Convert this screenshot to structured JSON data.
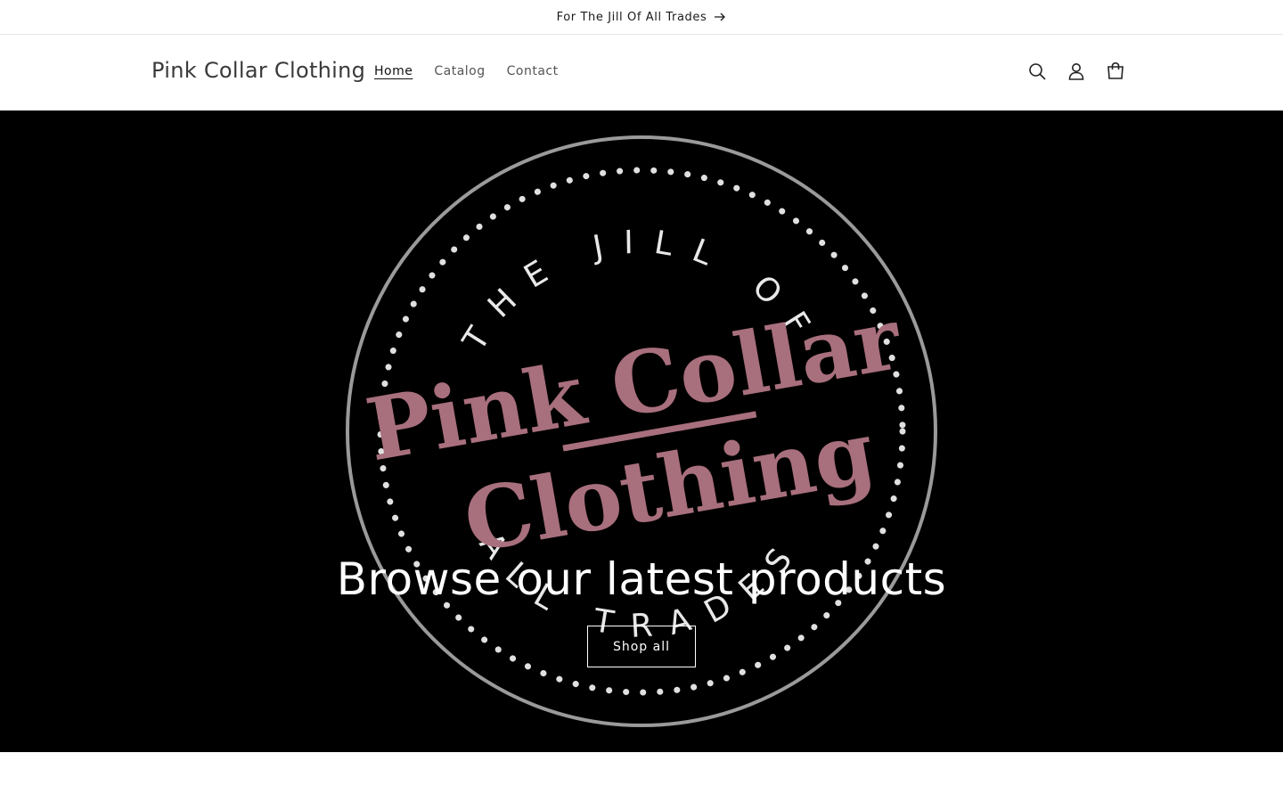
{
  "announcement": {
    "text": "For The Jill Of All Trades"
  },
  "header": {
    "brand": "Pink Collar Clothing",
    "nav": [
      {
        "label": "Home",
        "active": true
      },
      {
        "label": "Catalog",
        "active": false
      },
      {
        "label": "Contact",
        "active": false
      }
    ],
    "icons": [
      "search-icon",
      "account-icon",
      "cart-icon"
    ]
  },
  "hero": {
    "title": "Browse our latest products",
    "button_label": "Shop all",
    "logo": {
      "top_text": "THE JILL OF",
      "bottom_text": "ALL TRADES",
      "word1": "Pink Collar",
      "word2": "Clothing",
      "ring_color": "#9a9a9a",
      "brand_color": "#a86f7c"
    },
    "background": "#000000"
  },
  "colors": {
    "text": "#121212",
    "muted": "#555555",
    "border": "#e6e6e6"
  }
}
